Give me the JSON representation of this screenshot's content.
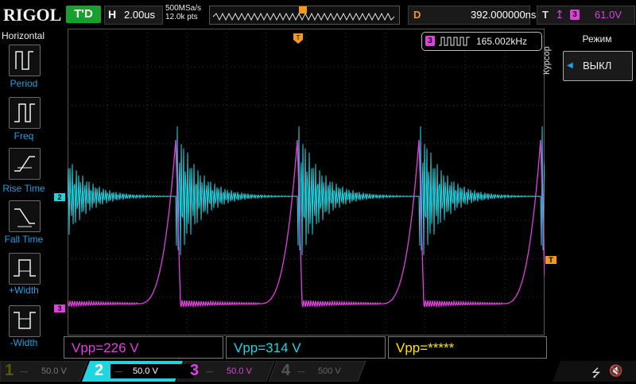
{
  "brand": "RIGOL",
  "run_state": "T'D",
  "timebase": {
    "label": "H",
    "value": "2.00us"
  },
  "sampling": {
    "rate": "500MSa/s",
    "points": "12.0k pts"
  },
  "delay": {
    "label": "D",
    "value": "392.000000ns"
  },
  "trigger": {
    "label": "T",
    "edge_icon": "rising-edge-icon",
    "channel": "3",
    "level": "61.0V"
  },
  "left_menu": {
    "title": "Horizontal",
    "items": [
      {
        "label": "Period",
        "icon": "period-icon"
      },
      {
        "label": "Freq",
        "icon": "frequency-icon"
      },
      {
        "label": "Rise Time",
        "icon": "rise-time-icon"
      },
      {
        "label": "Fall Time",
        "icon": "fall-time-icon"
      },
      {
        "label": "+Width",
        "icon": "positive-width-icon"
      },
      {
        "label": "-Width",
        "icon": "negative-width-icon"
      }
    ]
  },
  "right_menu": {
    "section": "Курсор",
    "mode_label": "Режим",
    "mode_value": "ВЫКЛ"
  },
  "counter": {
    "channel": "3",
    "value": "165.002kHz"
  },
  "markers": {
    "ch2": "2",
    "ch3": "3",
    "trig_top": "T",
    "trig_right": "T"
  },
  "measurements": [
    {
      "text": "Vpp=226 V",
      "color": "#e040e0"
    },
    {
      "text": "Vpp=314 V",
      "color": "#22d3e0"
    },
    {
      "text": "Vpp=*****",
      "color": "#ffe600"
    }
  ],
  "channels": [
    {
      "num": "1",
      "scale": "50.0 V",
      "color": "#f2e000",
      "active": false
    },
    {
      "num": "2",
      "scale": "50.0 V",
      "color": "#22d3e0",
      "active": true
    },
    {
      "num": "3",
      "scale": "50.0 V",
      "color": "#e040e0",
      "active": false
    },
    {
      "num": "4",
      "scale": "500 V",
      "color": "#4060ff",
      "active": false
    }
  ],
  "colors": {
    "ch2": "#22d3e0",
    "ch3": "#e040e0",
    "trigger": "#f39a1e",
    "accent": "#1fa0e6"
  }
}
